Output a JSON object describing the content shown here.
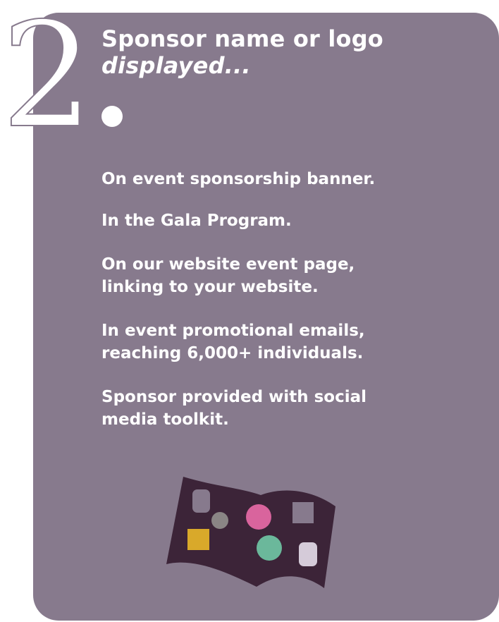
{
  "section": {
    "number": "2",
    "heading_line1": "Sponsor name or logo",
    "heading_line2": "displayed...",
    "benefits": [
      {
        "lines": [
          "On event sponsorship banner."
        ]
      },
      {
        "lines": [
          "In the Gala Program."
        ]
      },
      {
        "lines": [
          "On our website event page,",
          "linking to your website."
        ]
      },
      {
        "lines": [
          "In event promotional emails,",
          "reaching 6,000+ individuals."
        ]
      },
      {
        "lines": [
          "Sponsor provided with social",
          "media toolkit."
        ]
      }
    ]
  },
  "colors": {
    "card_background": "#877a8d",
    "text": "#ffffff",
    "flag_dark": "#3c2438",
    "pink": "#d9649d",
    "teal": "#6bb89b",
    "yellow": "#d9a92a",
    "gray_circle": "#8a8585"
  },
  "icons": [
    "big-number-two-outline",
    "white-dot-icon",
    "flag-illustration"
  ]
}
